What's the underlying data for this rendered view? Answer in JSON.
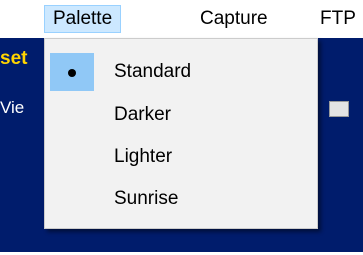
{
  "menubar": {
    "items": [
      {
        "label": "Palette",
        "active": true
      },
      {
        "label": "Capture",
        "active": false
      },
      {
        "label": "FTP",
        "active": false
      }
    ]
  },
  "background_app": {
    "title_text": "set",
    "label_text": "Vie"
  },
  "palette_menu": {
    "selected": "Standard",
    "options": [
      {
        "label": "Standard",
        "checked": true
      },
      {
        "label": "Darker",
        "checked": false
      },
      {
        "label": "Lighter",
        "checked": false
      },
      {
        "label": "Sunrise",
        "checked": false
      }
    ]
  },
  "colors": {
    "menu_hover_bg": "#cce8ff",
    "menu_hover_border": "#99d1ff",
    "check_highlight": "#90c8f6",
    "app_background": "#001c6c",
    "app_title_color": "#ffd400",
    "dropdown_bg": "#f2f2f2"
  }
}
